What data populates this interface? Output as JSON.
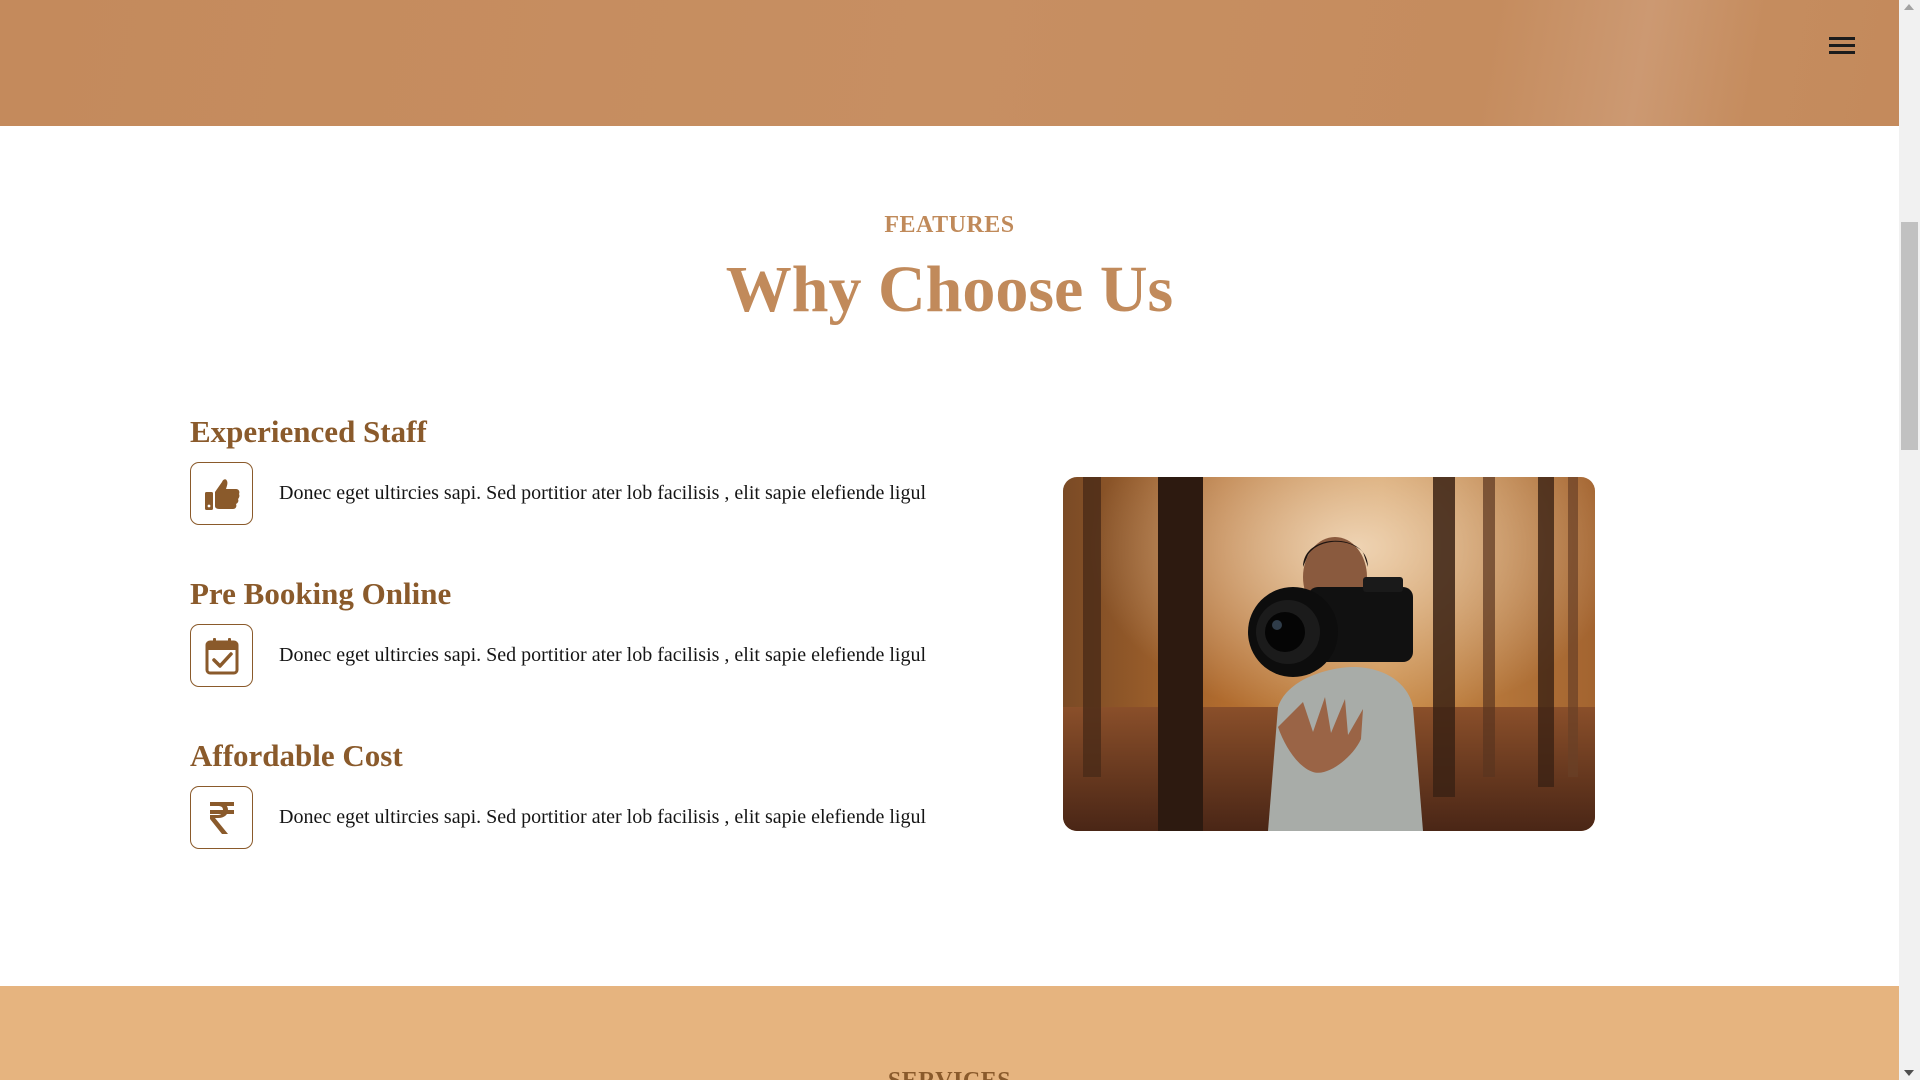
{
  "header": {
    "menu_icon": "hamburger-menu-icon",
    "background": "#c48a5c"
  },
  "features": {
    "eyebrow": "FEATURES",
    "title": "Why Choose Us",
    "items": [
      {
        "title": "Experienced Staff",
        "icon": "thumbs-up-icon",
        "text": "Donec eget ultircies sapi. Sed portitior ater lob facilisis , elit sapie elefiende ligul"
      },
      {
        "title": "Pre Booking Online",
        "icon": "calendar-check-icon",
        "text": "Donec eget ultircies sapi. Sed portitior ater lob facilisis , elit sapie elefiende ligul"
      },
      {
        "title": "Affordable Cost",
        "icon": "rupee-icon",
        "text": "Donec eget ultircies sapi. Sed portitior ater lob facilisis , elit sapie elefiende ligul"
      }
    ],
    "image": "photographer-camera-forest-photo"
  },
  "next_section": {
    "eyebrow": "SERVICES",
    "background": "#e6b47f"
  },
  "colors": {
    "accent": "#c18a5b",
    "dark_accent": "#8a5a2b",
    "text": "#151515"
  }
}
